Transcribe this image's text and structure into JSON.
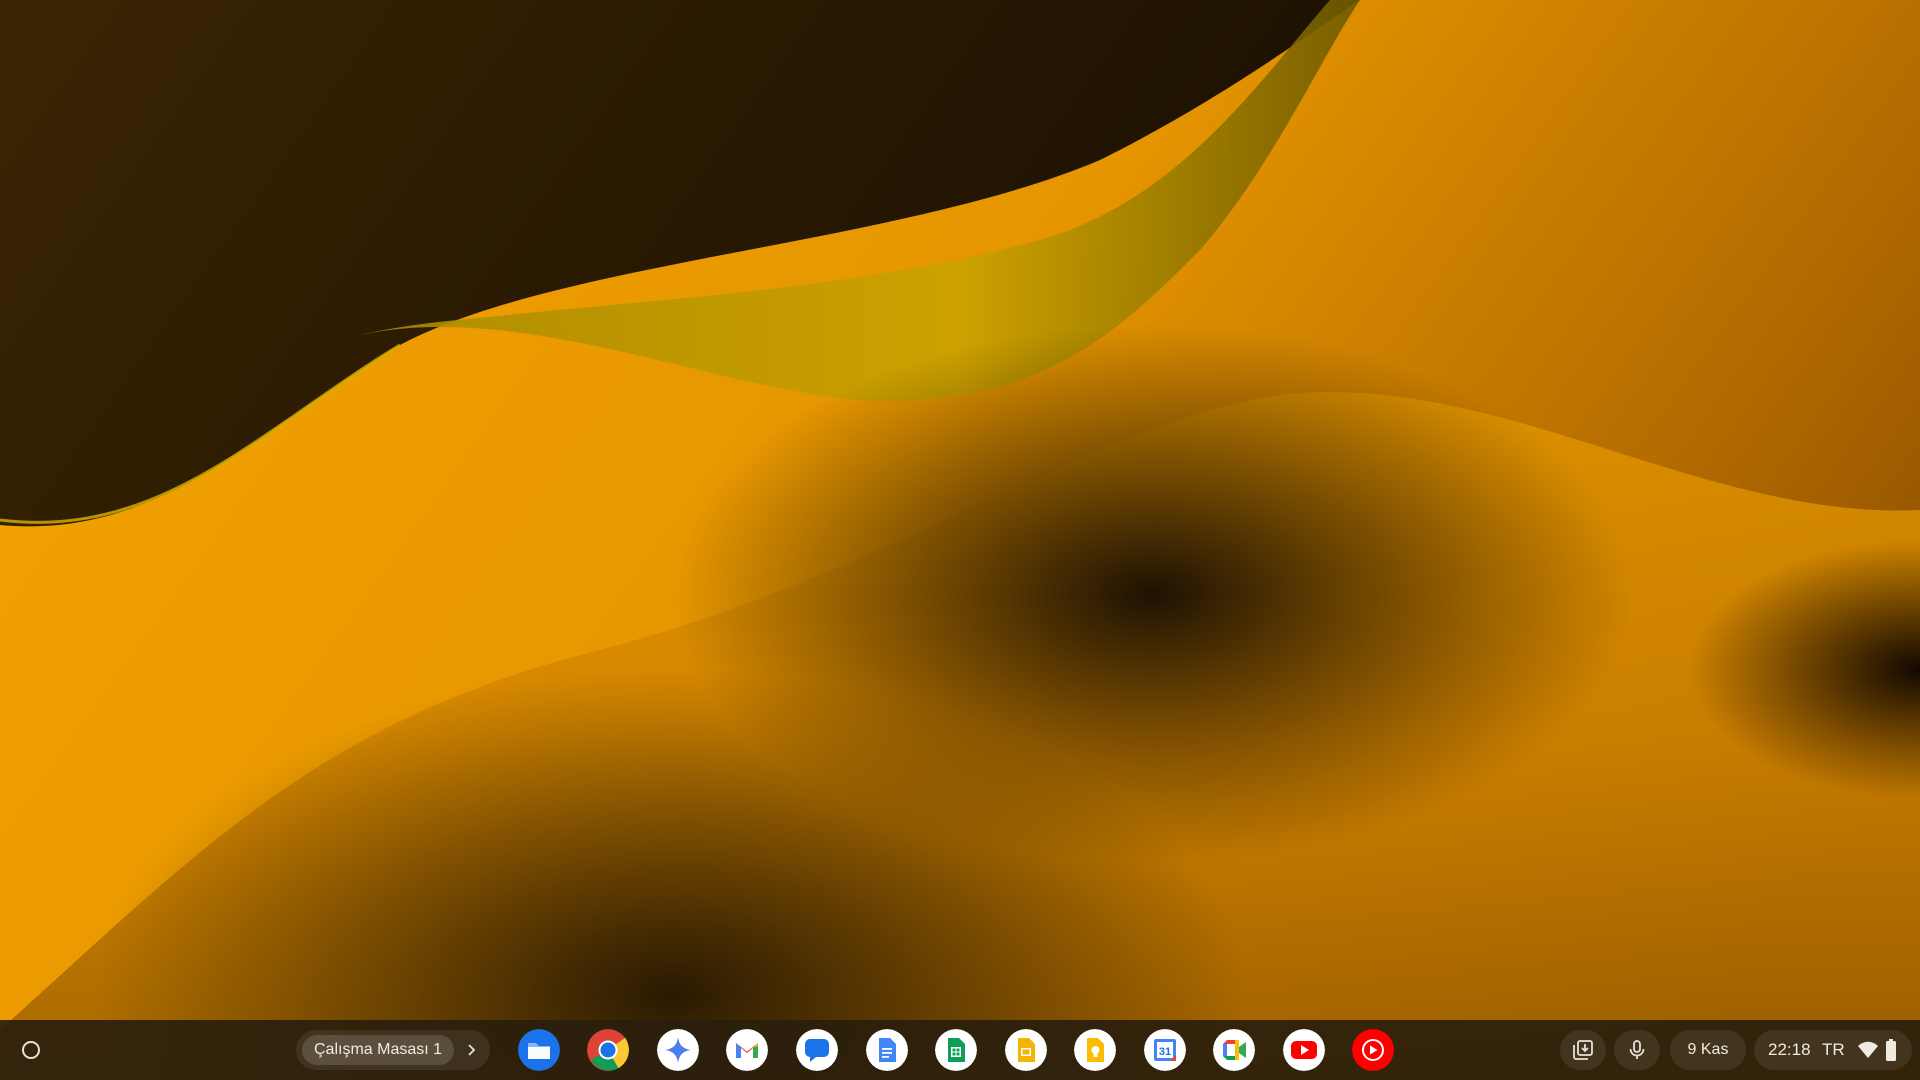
{
  "wallpaper": {
    "colors": {
      "dark": "#2a1a02",
      "amber": "#f0a000",
      "olive": "#c2a000"
    }
  },
  "shelf": {
    "launcher": {
      "icon": "launcher-circle-icon"
    },
    "desk": {
      "label": "Çalışma Masası 1",
      "next_icon": "chevron-right-icon"
    },
    "apps": [
      {
        "id": "files",
        "icon": "files-icon",
        "color": "#1a73e8"
      },
      {
        "id": "chrome",
        "icon": "chrome-icon"
      },
      {
        "id": "gemini",
        "icon": "gemini-icon"
      },
      {
        "id": "gmail",
        "icon": "gmail-icon"
      },
      {
        "id": "messages",
        "icon": "messages-icon",
        "color": "#1a73e8"
      },
      {
        "id": "docs",
        "icon": "docs-icon",
        "color": "#4285f4"
      },
      {
        "id": "sheets",
        "icon": "sheets-icon",
        "color": "#0f9d58"
      },
      {
        "id": "slides",
        "icon": "slides-icon",
        "color": "#f4b400"
      },
      {
        "id": "keep",
        "icon": "keep-icon",
        "color": "#fbbc04"
      },
      {
        "id": "calendar",
        "icon": "calendar-icon",
        "text": "31"
      },
      {
        "id": "meet",
        "icon": "meet-icon"
      },
      {
        "id": "youtube",
        "icon": "youtube-icon",
        "color": "#ff0000"
      },
      {
        "id": "youtube-music",
        "icon": "youtube-music-icon",
        "color": "#ff0000"
      }
    ],
    "tray": {
      "holding_space_icon": "holding-space-icon",
      "mic_icon": "microphone-icon",
      "date": "9 Kas",
      "time": "22:18",
      "ime": "TR",
      "wifi_icon": "wifi-icon",
      "battery_icon": "battery-icon"
    }
  }
}
